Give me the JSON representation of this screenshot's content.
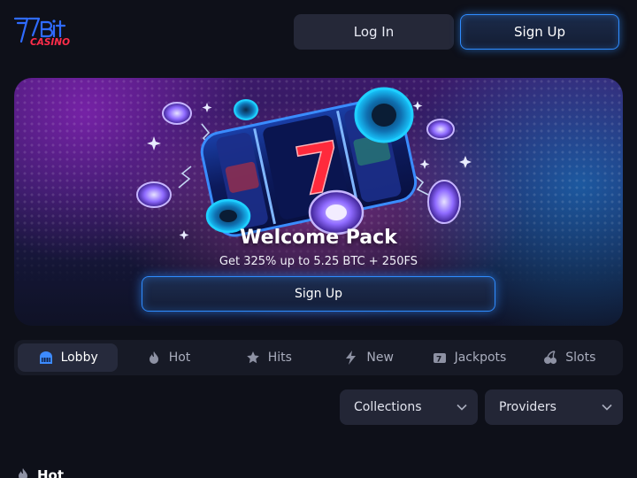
{
  "brand": {
    "logo_text": "7Bit",
    "logo_sub": "CASINO",
    "logo_blue": "#2f6bff",
    "logo_red": "#ff2d4a"
  },
  "header": {
    "login_label": "Log In",
    "signup_label": "Sign Up"
  },
  "promo": {
    "title": "Welcome Pack",
    "subtitle": "Get 325% up to 5.25 BTC + 250FS",
    "cta_label": "Sign Up",
    "reel_symbol": "7"
  },
  "tabs": [
    {
      "label": "Lobby",
      "icon": "lobby-icon",
      "active": true
    },
    {
      "label": "Hot",
      "icon": "flame-icon",
      "active": false
    },
    {
      "label": "Hits",
      "icon": "stars-icon",
      "active": false
    },
    {
      "label": "New",
      "icon": "lightning-icon",
      "active": false
    },
    {
      "label": "Jackpots",
      "icon": "jackpot-icon",
      "active": false
    },
    {
      "label": "Slots",
      "icon": "cherries-icon",
      "active": false
    }
  ],
  "filters": {
    "collections_label": "Collections",
    "providers_label": "Providers"
  },
  "section": {
    "title": "Hot",
    "icon": "flame-icon"
  },
  "colors": {
    "accent": "#2f8cff",
    "background": "#0e1019"
  }
}
